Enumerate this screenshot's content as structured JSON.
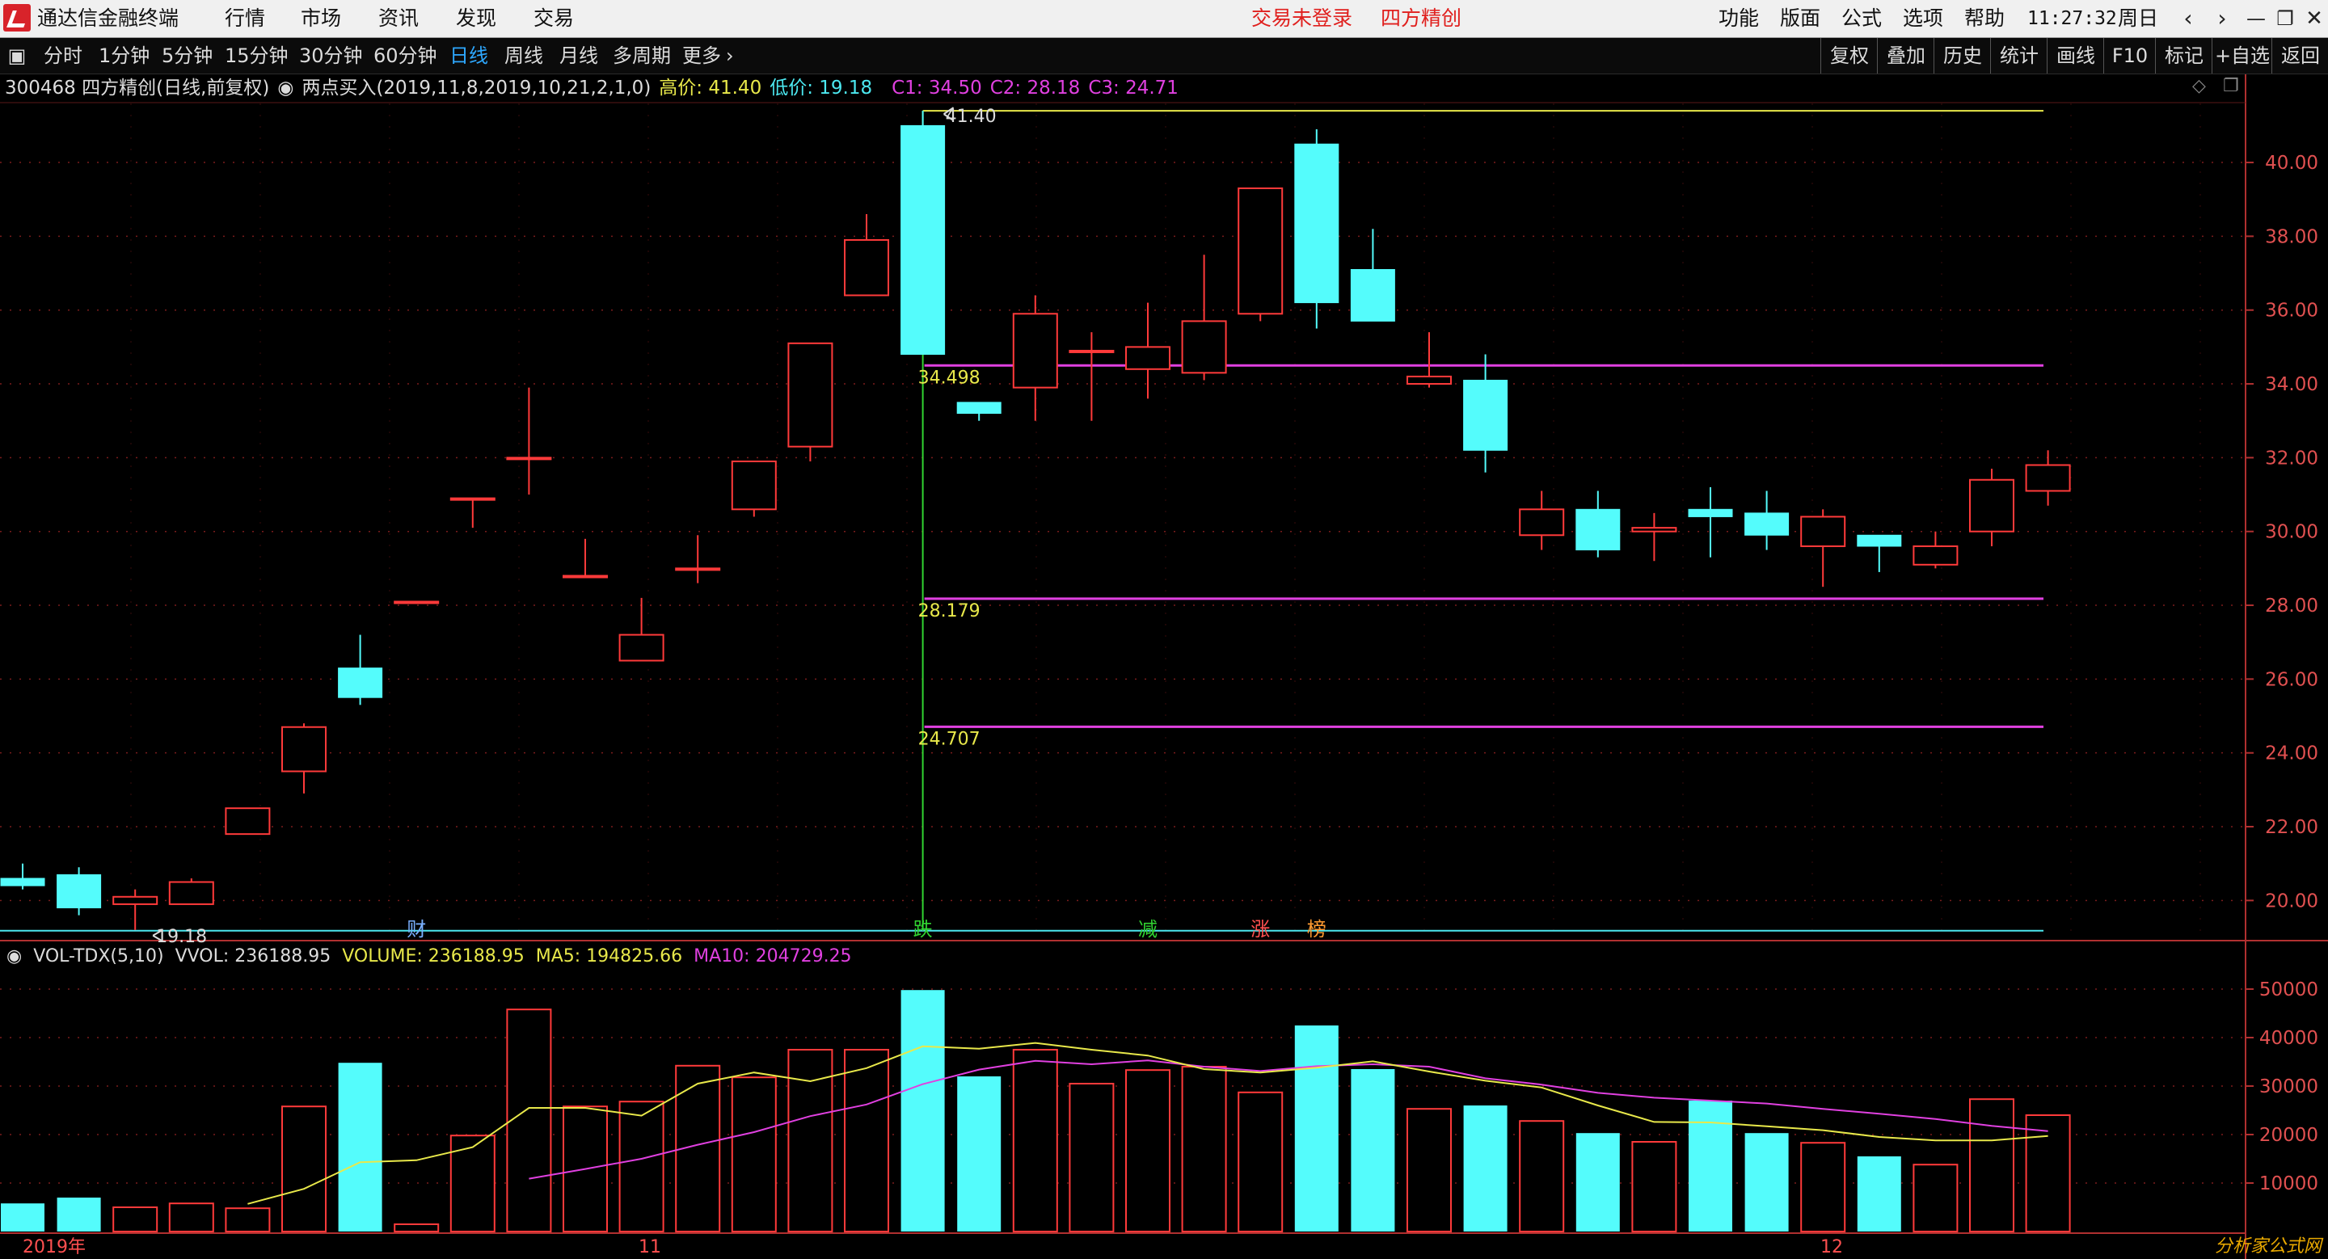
{
  "app": {
    "title": "通达信金融终端",
    "menus": [
      "行情",
      "市场",
      "资讯",
      "发现",
      "交易"
    ],
    "trade_status": "交易未登录",
    "stock_name": "四方精创",
    "right_menus": [
      "功能",
      "版面",
      "公式",
      "选项",
      "帮助"
    ],
    "clock": "11:27:32",
    "weekday": "周日"
  },
  "toolbar": {
    "periods": [
      "分时",
      "1分钟",
      "5分钟",
      "15分钟",
      "30分钟",
      "60分钟",
      "日线",
      "周线",
      "月线",
      "多周期",
      "更多"
    ],
    "selected": "日线",
    "right": [
      "复权",
      "叠加",
      "历史",
      "统计",
      "画线",
      "F10",
      "标记",
      "+自选",
      "返回"
    ]
  },
  "info": {
    "code_name": "300468 四方精创(日线,前复权)",
    "indicator": "两点买入(2019,11,8,2019,10,21,2,1,0)",
    "high": "高价: 41.40",
    "low": "低价: 19.18",
    "c1": "C1: 34.50",
    "c2": "C2: 28.18",
    "c3": "C3: 24.71"
  },
  "annotations": {
    "high_mark": "41.40",
    "low_mark": "19.18",
    "level1": "34.498",
    "level2": "28.179",
    "level3": "24.707",
    "events": [
      "财",
      "跌",
      "减",
      "涨",
      "榜"
    ]
  },
  "volume_info": {
    "name": "VOL-TDX(5,10)",
    "vvol": "VVOL: 236188.95",
    "volume": "VOLUME: 236188.95",
    "ma5": "MA5: 194825.66",
    "ma10": "MA10: 204729.25"
  },
  "xaxis": {
    "labels": [
      "2019年",
      "11",
      "12"
    ]
  },
  "colors": {
    "up": "#ff3a3a",
    "down": "#54fcfc",
    "level": "#e040e0",
    "ma5": "#e8e84a",
    "ma10": "#e040e0",
    "high_line": "#e8e84a",
    "low_line": "#4ce8f0",
    "marker_line": "#31d431"
  },
  "watermark": "分析家公式网",
  "chart_data": [
    {
      "type": "candlestick",
      "price_axis": {
        "ticks": [
          20,
          22,
          24,
          26,
          28,
          30,
          32,
          34,
          36,
          38,
          40
        ],
        "range": [
          19.0,
          41.6
        ]
      },
      "candles": [
        {
          "o": 20.6,
          "h": 21.0,
          "l": 20.3,
          "c": 20.4
        },
        {
          "o": 20.7,
          "h": 20.9,
          "l": 19.6,
          "c": 19.8
        },
        {
          "o": 19.9,
          "h": 20.3,
          "l": 19.2,
          "c": 20.1
        },
        {
          "o": 19.9,
          "h": 20.6,
          "l": 19.9,
          "c": 20.5
        },
        {
          "o": 21.8,
          "h": 22.5,
          "l": 21.8,
          "c": 22.5
        },
        {
          "o": 23.5,
          "h": 24.8,
          "l": 22.9,
          "c": 24.7
        },
        {
          "o": 26.3,
          "h": 27.2,
          "l": 25.3,
          "c": 25.5
        },
        {
          "o": 28.1,
          "h": 28.1,
          "l": 28.1,
          "c": 28.1
        },
        {
          "o": 30.9,
          "h": 30.9,
          "l": 30.1,
          "c": 30.9
        },
        {
          "o": 32.0,
          "h": 33.9,
          "l": 31.0,
          "c": 32.0
        },
        {
          "o": 28.8,
          "h": 29.8,
          "l": 28.8,
          "c": 28.8
        },
        {
          "o": 26.5,
          "h": 28.2,
          "l": 26.5,
          "c": 27.2
        },
        {
          "o": 29.0,
          "h": 29.9,
          "l": 28.6,
          "c": 29.0
        },
        {
          "o": 30.6,
          "h": 31.9,
          "l": 30.4,
          "c": 31.9
        },
        {
          "o": 32.3,
          "h": 35.1,
          "l": 31.9,
          "c": 35.1
        },
        {
          "o": 36.4,
          "h": 38.6,
          "l": 36.4,
          "c": 37.9
        },
        {
          "o": 41.0,
          "h": 41.4,
          "l": 34.8,
          "c": 34.8
        },
        {
          "o": 33.5,
          "h": 33.5,
          "l": 33.0,
          "c": 33.2
        },
        {
          "o": 33.9,
          "h": 36.4,
          "l": 33.0,
          "c": 35.9
        },
        {
          "o": 34.9,
          "h": 35.4,
          "l": 33.0,
          "c": 34.9
        },
        {
          "o": 34.4,
          "h": 36.2,
          "l": 33.6,
          "c": 35.0
        },
        {
          "o": 34.3,
          "h": 37.5,
          "l": 34.1,
          "c": 35.7
        },
        {
          "o": 35.9,
          "h": 39.3,
          "l": 35.7,
          "c": 39.3
        },
        {
          "o": 40.5,
          "h": 40.9,
          "l": 35.5,
          "c": 36.2
        },
        {
          "o": 37.1,
          "h": 38.2,
          "l": 35.7,
          "c": 35.7
        },
        {
          "o": 34.0,
          "h": 35.4,
          "l": 33.9,
          "c": 34.2
        },
        {
          "o": 34.1,
          "h": 34.8,
          "l": 31.6,
          "c": 32.2
        },
        {
          "o": 29.9,
          "h": 31.1,
          "l": 29.5,
          "c": 30.6
        },
        {
          "o": 30.6,
          "h": 31.1,
          "l": 29.3,
          "c": 29.5
        },
        {
          "o": 30.0,
          "h": 30.5,
          "l": 29.2,
          "c": 30.1
        },
        {
          "o": 30.6,
          "h": 31.2,
          "l": 29.3,
          "c": 30.4
        },
        {
          "o": 30.5,
          "h": 31.1,
          "l": 29.5,
          "c": 29.9
        },
        {
          "o": 29.6,
          "h": 30.6,
          "l": 28.5,
          "c": 30.4
        },
        {
          "o": 29.9,
          "h": 29.9,
          "l": 28.9,
          "c": 29.6
        },
        {
          "o": 29.1,
          "h": 30.0,
          "l": 29.0,
          "c": 29.6
        },
        {
          "o": 30.0,
          "h": 31.7,
          "l": 29.6,
          "c": 31.4
        },
        {
          "o": 31.1,
          "h": 32.2,
          "l": 30.7,
          "c": 31.8
        }
      ],
      "levels": [
        34.498,
        28.179,
        24.707
      ],
      "high": 41.4,
      "low": 19.18
    },
    {
      "type": "bar",
      "title": "VOL-TDX(5,10)",
      "yaxis": {
        "ticks": [
          10000,
          20000,
          30000,
          40000,
          50000
        ],
        "range": [
          0,
          54000
        ]
      },
      "volumes": [
        5800,
        7000,
        5000,
        5800,
        4800,
        25800,
        34800,
        1500,
        19800,
        45800,
        25800,
        26800,
        34200,
        31800,
        37500,
        37500,
        49800,
        32000,
        37500,
        30500,
        33300,
        34000,
        28700,
        42500,
        33500,
        25300,
        26000,
        22800,
        20300,
        18500,
        27000,
        20300,
        18300,
        15500,
        13800,
        27300,
        24000
      ],
      "ma5": [
        null,
        null,
        null,
        null,
        5700,
        8800,
        14300,
        14700,
        17400,
        25500,
        25500,
        23900,
        30500,
        32800,
        31000,
        33700,
        38200,
        37700,
        38900,
        37500,
        36300,
        33500,
        32800,
        33800,
        35100,
        33000,
        31100,
        29700,
        26000,
        22600,
        22500,
        21700,
        20900,
        19500,
        18800,
        18800,
        19700
      ],
      "ma10": [
        null,
        null,
        null,
        null,
        null,
        null,
        null,
        null,
        null,
        10900,
        12900,
        15000,
        17900,
        20500,
        23800,
        26200,
        30400,
        33400,
        35200,
        34500,
        35300,
        34000,
        33100,
        34100,
        34500,
        34000,
        31600,
        30300,
        28600,
        27600,
        27000,
        26400,
        25300,
        24300,
        23200,
        21800,
        20700
      ]
    }
  ]
}
